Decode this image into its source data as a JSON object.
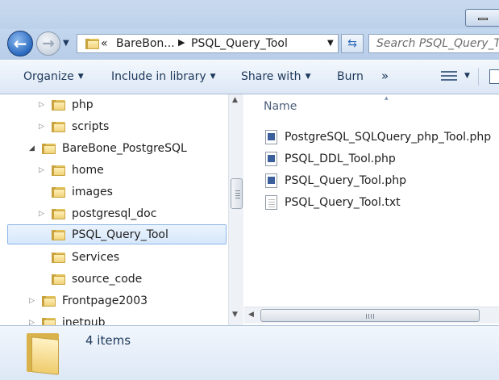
{
  "address_bar": {
    "overflow_chevron": "«",
    "segments": [
      "BareBon...",
      "PSQL_Query_Tool"
    ]
  },
  "search": {
    "placeholder": "Search PSQL_Query_Tool"
  },
  "toolbar": {
    "organize": "Organize",
    "include_in_library": "Include in library",
    "share_with": "Share with",
    "burn": "Burn",
    "more": "»"
  },
  "nav_tree": [
    {
      "label": "php",
      "expander": "▷",
      "selected": false
    },
    {
      "label": "scripts",
      "expander": "▷",
      "selected": false
    },
    {
      "label": "BareBone_PostgreSQL",
      "expander": "◢",
      "selected": false
    },
    {
      "label": "home",
      "expander": "▷",
      "selected": false
    },
    {
      "label": "images",
      "expander": "",
      "selected": false
    },
    {
      "label": "postgresql_doc",
      "expander": "▷",
      "selected": false
    },
    {
      "label": "PSQL_Query_Tool",
      "expander": "",
      "selected": true
    },
    {
      "label": "Services",
      "expander": "",
      "selected": false
    },
    {
      "label": "source_code",
      "expander": "",
      "selected": false
    },
    {
      "label": "Frontpage2003",
      "expander": "▷",
      "selected": false
    },
    {
      "label": "inetpub",
      "expander": "▷",
      "selected": false
    }
  ],
  "content": {
    "column_header": "Name",
    "files": [
      {
        "name": "PostgreSQL_SQLQuery_php_Tool.php",
        "type": "php"
      },
      {
        "name": "PSQL_DDL_Tool.php",
        "type": "php"
      },
      {
        "name": "PSQL_Query_Tool.php",
        "type": "php"
      },
      {
        "name": "PSQL_Query_Tool.txt",
        "type": "txt"
      }
    ]
  },
  "status": {
    "item_count": "4 items"
  }
}
